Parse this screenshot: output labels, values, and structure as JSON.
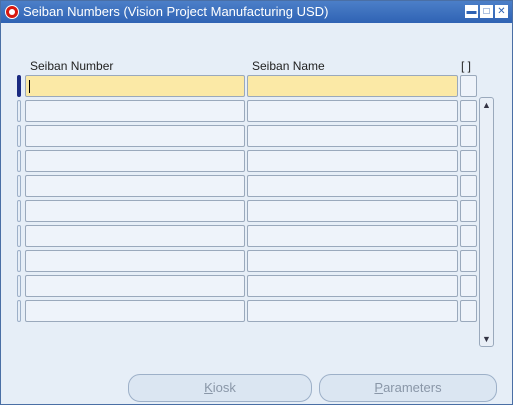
{
  "window": {
    "title": "Seiban Numbers (Vision Project Manufacturing USD)"
  },
  "window_controls": {
    "minimize": "▬",
    "maximize": "□",
    "close": "✕"
  },
  "columns": {
    "seiban_number": "Seiban Number",
    "seiban_name": "Seiban Name",
    "flag": "[ ]"
  },
  "rows": [
    {
      "seiban_number": "",
      "seiban_name": ""
    },
    {
      "seiban_number": "",
      "seiban_name": ""
    },
    {
      "seiban_number": "",
      "seiban_name": ""
    },
    {
      "seiban_number": "",
      "seiban_name": ""
    },
    {
      "seiban_number": "",
      "seiban_name": ""
    },
    {
      "seiban_number": "",
      "seiban_name": ""
    },
    {
      "seiban_number": "",
      "seiban_name": ""
    },
    {
      "seiban_number": "",
      "seiban_name": ""
    },
    {
      "seiban_number": "",
      "seiban_name": ""
    },
    {
      "seiban_number": "",
      "seiban_name": ""
    }
  ],
  "scrollbar": {
    "up": "▲",
    "down": "▼"
  },
  "buttons": {
    "kiosk": {
      "mnemonic": "K",
      "rest": "iosk"
    },
    "parameters": {
      "mnemonic": "P",
      "rest": "arameters"
    }
  },
  "colors": {
    "titlebar": "#2f63b4",
    "current_record": "#fbe9a6",
    "form_bg": "#e6eef7"
  }
}
